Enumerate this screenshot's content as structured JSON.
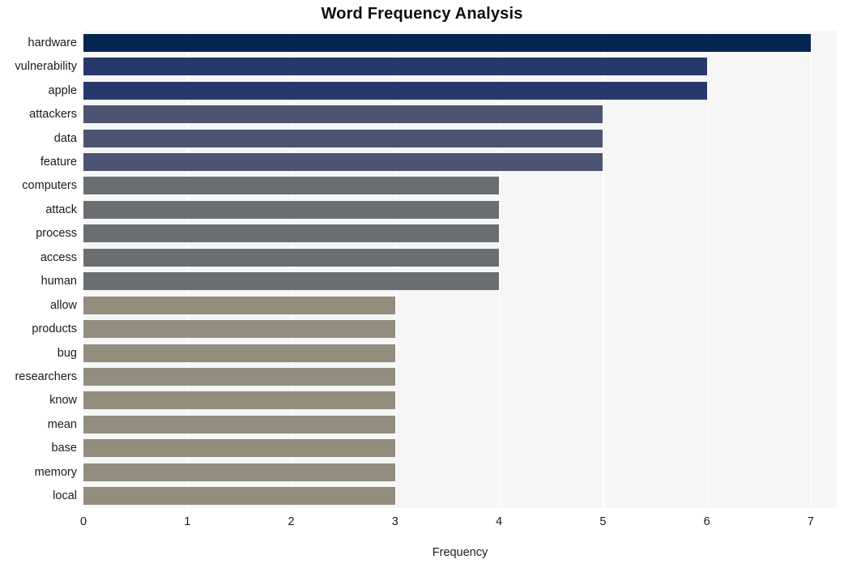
{
  "chart_data": {
    "type": "bar",
    "orientation": "horizontal",
    "title": "Word Frequency Analysis",
    "xlabel": "Frequency",
    "ylabel": "",
    "xlim": [
      0,
      7.25
    ],
    "xticks": [
      "0",
      "1",
      "2",
      "3",
      "4",
      "5",
      "6",
      "7"
    ],
    "xtick_values": [
      0,
      1,
      2,
      3,
      4,
      5,
      6,
      7
    ],
    "grid": "vertical-white",
    "legend": "none",
    "categories": [
      "hardware",
      "vulnerability",
      "apple",
      "attackers",
      "data",
      "feature",
      "computers",
      "attack",
      "process",
      "access",
      "human",
      "allow",
      "products",
      "bug",
      "researchers",
      "know",
      "mean",
      "base",
      "memory",
      "local"
    ],
    "values": [
      7,
      6,
      6,
      5,
      5,
      5,
      4,
      4,
      4,
      4,
      4,
      3,
      3,
      3,
      3,
      3,
      3,
      3,
      3,
      3
    ],
    "bar_colors": [
      "#052650",
      "#27396b",
      "#27396b",
      "#4d5472",
      "#4d5472",
      "#4d5472",
      "#6b6e71",
      "#6b6e71",
      "#6b6e71",
      "#6b6e71",
      "#6b6e71",
      "#928d7d",
      "#928d7d",
      "#928d7d",
      "#928d7d",
      "#928d7d",
      "#928d7d",
      "#928d7d",
      "#928d7d",
      "#928d7d"
    ]
  },
  "style": {
    "plot_background": "#f6f6f7",
    "figure_background": "#ffffff",
    "gridline_color": "#ffffff",
    "text_color": "#1a1a1a",
    "title_color": "#0d0d0d"
  }
}
